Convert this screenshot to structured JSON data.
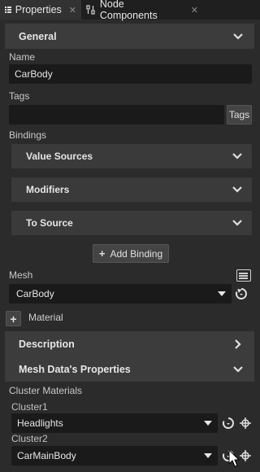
{
  "tabs": [
    {
      "label": "Properties",
      "icon": "list-icon",
      "active": true
    },
    {
      "label": "Node Components",
      "icon": "node-components-icon",
      "active": false
    }
  ],
  "general": {
    "header": "General",
    "name_label": "Name",
    "name_value": "CarBody",
    "tags_label": "Tags",
    "tags_value": "",
    "tags_button": "Tags",
    "bindings_label": "Bindings",
    "value_sources": "Value Sources",
    "modifiers": "Modifiers",
    "to_source": "To Source",
    "add_binding": "Add Binding"
  },
  "mesh": {
    "label": "Mesh",
    "value": "CarBody",
    "material_label": "Material"
  },
  "description": {
    "header": "Description"
  },
  "mesh_data": {
    "header": "Mesh Data's Properties",
    "cluster_materials_label": "Cluster Materials",
    "clusters": [
      {
        "label": "Cluster1",
        "value": "Headlights"
      },
      {
        "label": "Cluster2",
        "value": "CarMainBody"
      }
    ]
  },
  "colors": {
    "background": "#2b2b2b",
    "section": "#3c3c3c",
    "field": "#1a1a1a"
  }
}
